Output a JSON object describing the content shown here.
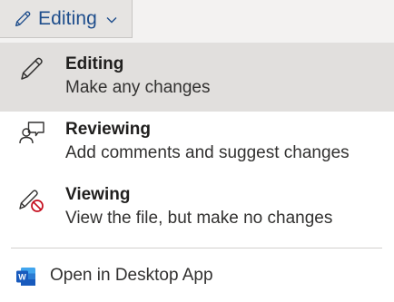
{
  "mode_button": {
    "label": "Editing",
    "icon": "pencil-icon"
  },
  "menu": {
    "items": [
      {
        "title": "Editing",
        "description": "Make any changes",
        "icon": "pencil-icon",
        "selected": true
      },
      {
        "title": "Reviewing",
        "description": "Add comments and suggest changes",
        "icon": "reviewer-comment-icon",
        "selected": false
      },
      {
        "title": "Viewing",
        "description": "View the file, but make no changes",
        "icon": "pencil-blocked-icon",
        "selected": false
      }
    ],
    "open_desktop": {
      "label": "Open in Desktop App",
      "icon": "word-icon"
    }
  },
  "colors": {
    "accent": "#1f4e8c",
    "selected_bg": "#e1dfdd",
    "blocked_red": "#c50f1f",
    "word_blue": "#185abd"
  }
}
